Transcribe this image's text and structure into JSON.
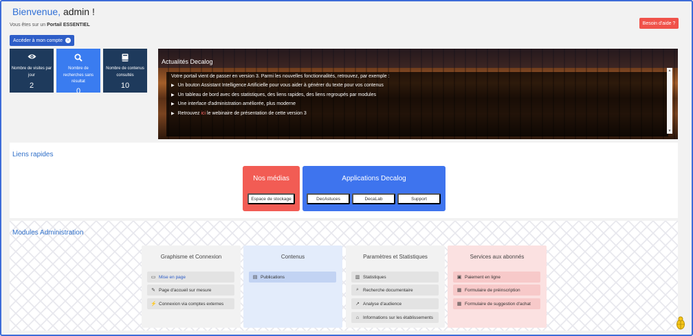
{
  "header": {
    "welcome_prefix": "Bienvenue,",
    "welcome_user": " admin !",
    "portal_prefix": "Vous êtes sur un ",
    "portal_name": "Portail ESSENTIEL",
    "help_label": "Besoin d'aide ?",
    "account_label": "Accéder à mon compte"
  },
  "stats": [
    {
      "icon": "eye-icon",
      "label": "Nombre de visites par jour",
      "value": "2"
    },
    {
      "icon": "search-icon",
      "label": "Nombre de recherches sans résultat",
      "value": "0"
    },
    {
      "icon": "book-icon",
      "label": "Nombre de contenus consultés",
      "value": "10"
    }
  ],
  "news": {
    "title": "Actualités Decalog",
    "intro": "Votre portail vient de passer en version 3. Parmi les nouvelles fonctionnalités, retrouvez, par exemple :",
    "items": [
      "Un bouton Assistant Intelligence Artificielle pour vous aider à générer du texte pour vos contenus",
      "Un tableau de bord avec des statistiques, des liens rapides, des liens regroupés par modules",
      "Une interface d'administration améliorée, plus moderne"
    ],
    "last_prefix": "Retrouvez ",
    "last_link": "ici",
    "last_suffix": " le webinaire de présentation de cette version 3"
  },
  "quick_links": {
    "title": "Liens rapides",
    "medias": {
      "title": "Nos médias",
      "buttons": [
        "Espace de stockage"
      ]
    },
    "apps": {
      "title": "Applications Decalog",
      "buttons": [
        "DecAstuces",
        "DecaLab",
        "Support"
      ]
    }
  },
  "modules": {
    "title": "Modules Administration",
    "columns": [
      {
        "title": "Graphisme et Connexion",
        "items": [
          {
            "icon": "monitor-icon",
            "label": "Mise en page"
          },
          {
            "icon": "pencil-icon",
            "label": "Page d'accueil sur mesure"
          },
          {
            "icon": "plug-icon",
            "label": "Connexion via comptes externes"
          }
        ]
      },
      {
        "title": "Contenus",
        "items": [
          {
            "icon": "document-icon",
            "label": "Publications"
          }
        ]
      },
      {
        "title": "Paramètres et Statistiques",
        "items": [
          {
            "icon": "bar-chart-icon",
            "label": "Statistiques"
          },
          {
            "icon": "search-icon",
            "label": "Recherche documentaire"
          },
          {
            "icon": "line-chart-icon",
            "label": "Analyse d'audience"
          },
          {
            "icon": "home-icon",
            "label": "Informations sur les établissements"
          }
        ]
      },
      {
        "title": "Services aux abonnés",
        "items": [
          {
            "icon": "payment-icon",
            "label": "Paiement en ligne"
          },
          {
            "icon": "form-icon",
            "label": "Formulaire de préinscription"
          },
          {
            "icon": "form-icon",
            "label": "Formulaire de suggestion d'achat"
          }
        ]
      }
    ]
  },
  "colors": {
    "accent_blue": "#2e5ec8",
    "tile_dark": "#1e3a5c",
    "tile_blue": "#3a7cf0",
    "alert_red": "#f0524a"
  }
}
